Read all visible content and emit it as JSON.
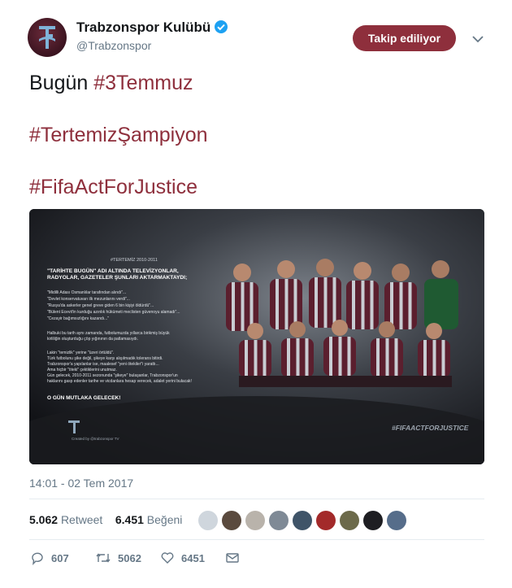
{
  "account": {
    "name": "Trabzonspor Kulübü",
    "handle": "@Trabzonspor",
    "verified_icon": "verified-badge-icon"
  },
  "follow_button": {
    "label": "Takip ediliyor"
  },
  "tweet": {
    "prefix": "Bugün ",
    "hashtags": [
      "#3Temmuz",
      "#TertemizŞampiyon",
      "#FifaActForJustice"
    ]
  },
  "media": {
    "tag_small": "#TERTEMİZ 2010-2011",
    "headline": "\"TARİHTE BUGÜN\" ADI ALTINDA TELEVİZYONLAR, RADYOLAR, GAZETELER ŞUNLARI AKTARMAKTAYDI;",
    "quotes": [
      "\"Midilli Adası Osmanlılar tarafından alındı\"...",
      "\"Devlet konservatuvarı ilk mezunlarını verdi\"...",
      "\"Rusya'da askerler genel greve giden 6 bin kişiyi öldürdü\"...",
      "\"Bülent Ecevit'in kurduğu azınlık hükümeti meclisten güvenoyu alamadı\"...",
      "\"Cezayir bağımsızlığını kazandı...\""
    ],
    "para1": "Halbuki bu tarih aynı zamanda, futbolumuzda yıllarca birikmiş büyük kirliliğin oluşturduğu çöp yığınının da patlamasıydı.",
    "para2": "Lakin \"temizlik\" yerine \"üzeri örtüldü\". Türk futbolunu şike değil, şikeye karşı alışılmadık tolerans bitirdi. Trabzonspor'a yapılanlar ise, maalesef \"yeni ötekiler\"i yarattı... Ama hiçbir \"öteki\" çektiklerini unutmaz. Gün gelecek, 2010-2011 sezonunda \"şikeye\" bulaşanlar, Trabzonspor'un haklarını gasp edenler tarihe ve vicdanlara hesap verecek, adalet yerini bulacak!",
    "closing": "O GÜN MUTLAKA GELECEK!",
    "footer_hashtag": "#FIFAACTFORJUSTICE",
    "credit": "Created by @trabzonspor TV"
  },
  "timestamp": "14:01 - 02 Tem 2017",
  "stats": {
    "retweets_count": "5.062",
    "retweets_label": "Retweet",
    "likes_count": "6.451",
    "likes_label": "Beğeni"
  },
  "actions": {
    "replies": "607",
    "retweets": "5062",
    "likes": "6451"
  },
  "colors": {
    "brand": "#8e2f3c",
    "text": "#14171a",
    "muted": "#657786",
    "verified": "#1da1f2"
  }
}
